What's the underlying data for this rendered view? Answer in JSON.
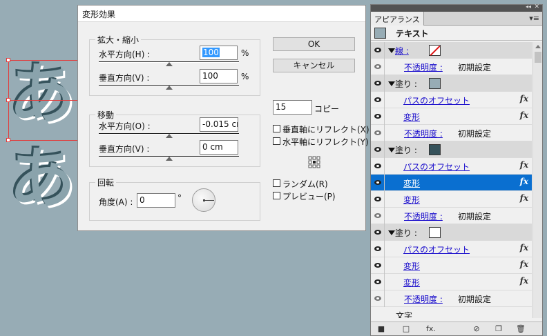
{
  "canvas": {
    "glyphs": [
      "あ",
      "あ"
    ]
  },
  "dialog": {
    "title": "変形効果",
    "scale": {
      "legend": "拡大・縮小",
      "horizontal_label": "水平方向(H) :",
      "horizontal_value": "100",
      "horizontal_unit": "%",
      "vertical_label": "垂直方向(V) :",
      "vertical_value": "100",
      "vertical_unit": "%"
    },
    "move": {
      "legend": "移動",
      "horizontal_label": "水平方向(O) :",
      "horizontal_value": "-0.015 cı",
      "vertical_label": "垂直方向(V) :",
      "vertical_value": "0 cm"
    },
    "rotate": {
      "legend": "回転",
      "angle_label": "角度(A) :",
      "angle_value": "0",
      "angle_unit": "°"
    },
    "ok_label": "OK",
    "cancel_label": "キャンセル",
    "copies_value": "15",
    "copies_label": "コピー",
    "reflect_x_label": "垂直軸にリフレクト(X)",
    "reflect_y_label": "水平軸にリフレクト(Y)",
    "random_label": "ランダム(R)",
    "preview_label": "プレビュー(P)",
    "reflect_x_checked": false,
    "reflect_y_checked": false,
    "random_checked": false,
    "preview_checked": false
  },
  "panel": {
    "collapse_glyph": "◂◂",
    "close_glyph": "✕",
    "tab_label": "アピアランス",
    "menu_glyph": "▾≡",
    "header_label": "テキスト",
    "rows": [
      {
        "kind": "section",
        "label": "線 :",
        "link": true,
        "swatch": "none"
      },
      {
        "kind": "item",
        "label": "不透明度 :",
        "value": "初期設定",
        "indent": 2
      },
      {
        "kind": "section",
        "label": "塗り :",
        "link": false,
        "swatch": "#97acb5"
      },
      {
        "kind": "item",
        "label": "パスのオフセット",
        "fx": "fx",
        "indent": 1
      },
      {
        "kind": "item",
        "label": "変形",
        "fx": "fx",
        "indent": 1
      },
      {
        "kind": "item",
        "label": "不透明度 :",
        "value": "初期設定",
        "indent": 2
      },
      {
        "kind": "section",
        "label": "塗り :",
        "link": false,
        "swatch": "#35525b"
      },
      {
        "kind": "item",
        "label": "パスのオフセット",
        "fx": "fx",
        "indent": 1
      },
      {
        "kind": "item",
        "label": "変形",
        "fx": "fx",
        "indent": 1,
        "selected": true
      },
      {
        "kind": "item",
        "label": "変形",
        "fx": "fx",
        "indent": 1
      },
      {
        "kind": "item",
        "label": "不透明度 :",
        "value": "初期設定",
        "indent": 2
      },
      {
        "kind": "section",
        "label": "塗り :",
        "link": false,
        "swatch": "#ffffff"
      },
      {
        "kind": "item",
        "label": "パスのオフセット",
        "fx": "fx",
        "indent": 1
      },
      {
        "kind": "item",
        "label": "変形",
        "fx": "fx",
        "indent": 1
      },
      {
        "kind": "item",
        "label": "変形",
        "fx": "fx",
        "indent": 1
      },
      {
        "kind": "item",
        "label": "不透明度 :",
        "value": "初期設定",
        "indent": 2
      },
      {
        "kind": "plain",
        "label": "文字"
      }
    ],
    "bottom_icons": [
      {
        "name": "new-art-basic-icon",
        "glyph": "■"
      },
      {
        "name": "new-stroke-icon",
        "glyph": "□"
      },
      {
        "name": "add-effect-icon",
        "glyph": "fx."
      },
      {
        "name": "clear-appearance-icon",
        "glyph": "⊘"
      },
      {
        "name": "duplicate-item-icon",
        "glyph": "❐"
      },
      {
        "name": "delete-item-icon",
        "glyph": "🗑"
      }
    ]
  }
}
